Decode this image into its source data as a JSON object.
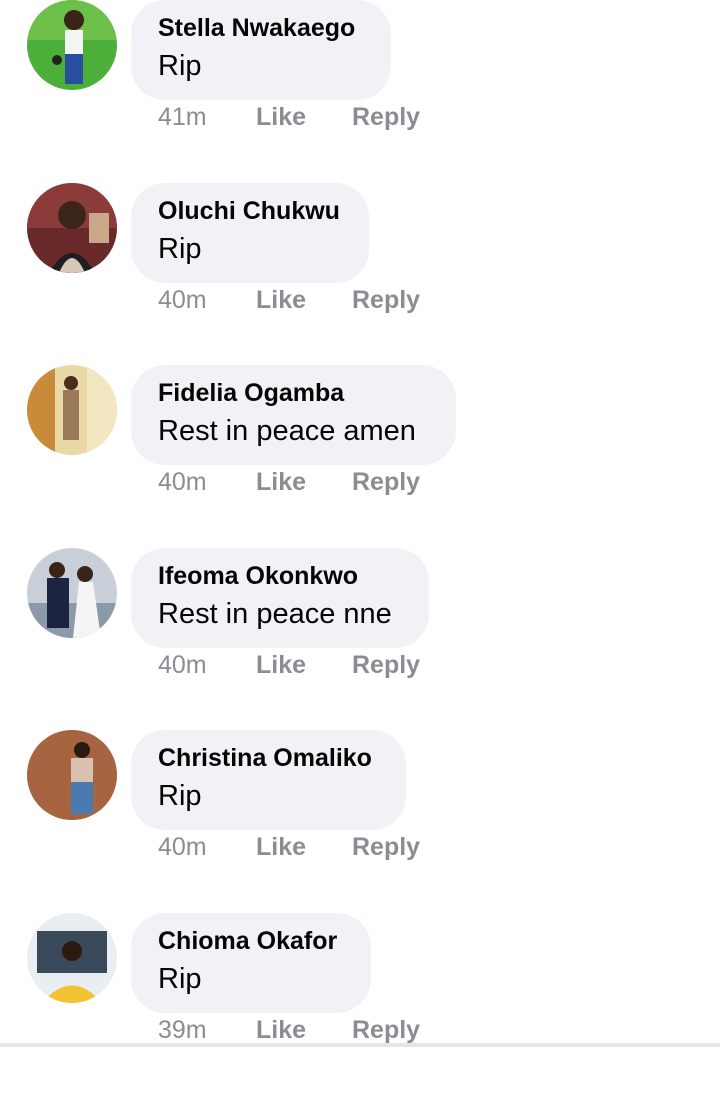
{
  "comments": [
    {
      "author": "Stella Nwakaego",
      "text": "Rip",
      "time": "41m",
      "like": "Like",
      "reply": "Reply"
    },
    {
      "author": "Oluchi Chukwu",
      "text": "Rip",
      "time": "40m",
      "like": "Like",
      "reply": "Reply"
    },
    {
      "author": "Fidelia Ogamba",
      "text": "Rest in peace amen",
      "time": "40m",
      "like": "Like",
      "reply": "Reply"
    },
    {
      "author": "Ifeoma Okonkwo",
      "text": "Rest in peace nne",
      "time": "40m",
      "like": "Like",
      "reply": "Reply"
    },
    {
      "author": "Christina Omaliko",
      "text": "Rip",
      "time": "40m",
      "like": "Like",
      "reply": "Reply"
    },
    {
      "author": "Chioma Okafor",
      "text": "Rip",
      "time": "39m",
      "like": "Like",
      "reply": "Reply"
    }
  ],
  "colors": {
    "bubble": "#f0f2f5",
    "name": "#050505",
    "meta": "#8a8d91"
  }
}
